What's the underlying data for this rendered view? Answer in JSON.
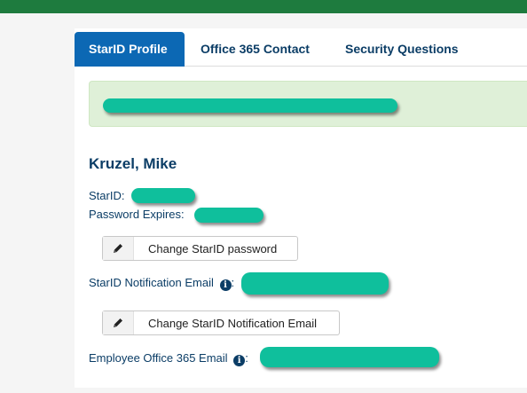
{
  "tabs": [
    {
      "label": "StarID Profile",
      "active": true
    },
    {
      "label": "Office 365 Contact",
      "active": false
    },
    {
      "label": "Security Questions",
      "active": false
    }
  ],
  "profile": {
    "name": "Kruzel, Mike",
    "starid_label": "StarID:",
    "password_expires_label": "Password Expires:",
    "change_password_label": "Change StarID password",
    "notification_email_label": "StarID Notification Email",
    "notification_email_suffix": ":",
    "change_notification_email_label": "Change StarID Notification Email",
    "office365_email_label": "Employee Office 365 Email",
    "office365_email_suffix": ":"
  },
  "icons": {
    "info": "info-circle-icon",
    "edit": "pencil-icon"
  },
  "colors": {
    "top_bar": "#1e7b3e",
    "tab_active": "#0c68b4",
    "text_primary": "#0b3d66",
    "success_bg": "#dff0d8",
    "redaction": "#0fbf9c"
  }
}
